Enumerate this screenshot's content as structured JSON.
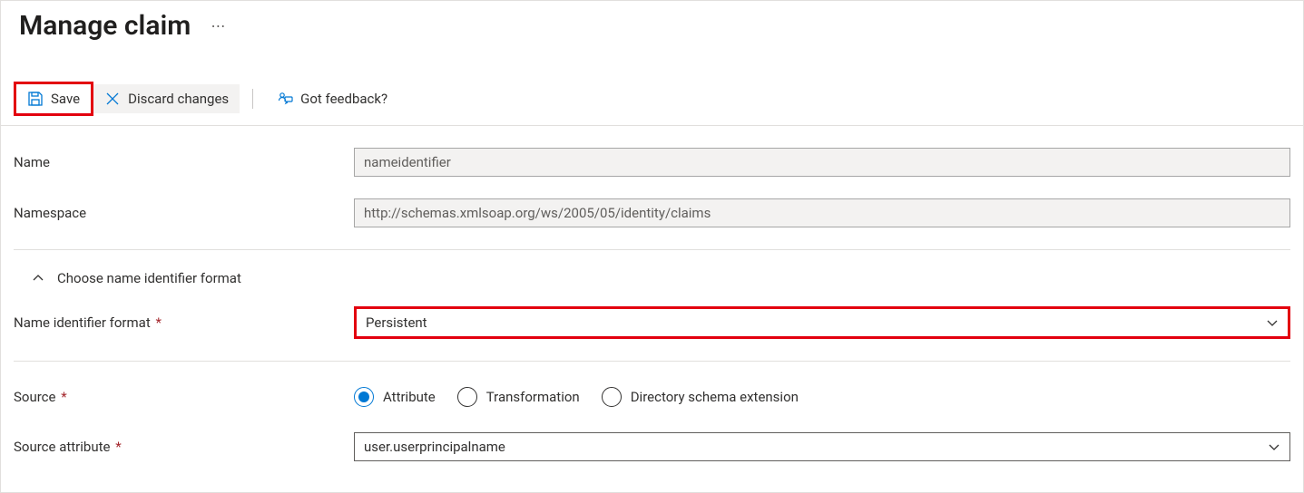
{
  "header": {
    "title": "Manage claim"
  },
  "toolbar": {
    "save_label": "Save",
    "discard_label": "Discard changes",
    "feedback_label": "Got feedback?"
  },
  "form": {
    "name_label": "Name",
    "name_value": "nameidentifier",
    "namespace_label": "Namespace",
    "namespace_value": "http://schemas.xmlsoap.org/ws/2005/05/identity/claims",
    "expander_label": "Choose name identifier format",
    "name_id_format_label": "Name identifier format",
    "name_id_format_value": "Persistent",
    "source_label": "Source",
    "source_options": {
      "attribute": "Attribute",
      "transformation": "Transformation",
      "directory": "Directory schema extension"
    },
    "source_attribute_label": "Source attribute",
    "source_attribute_value": "user.userprincipalname"
  }
}
